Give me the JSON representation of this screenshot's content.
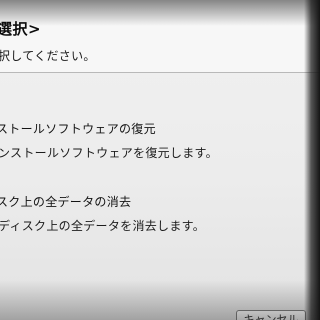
{
  "dialog": {
    "title": "選択>",
    "subtitle": "択してください。",
    "options": [
      {
        "label": "ストールソフトウェアの復元",
        "description": "ンストールソフトウェアを復元します。"
      },
      {
        "label": "スク上の全データの消去",
        "description": "ディスク上の全データを消去します。"
      }
    ],
    "button_label": "キャンセル"
  }
}
